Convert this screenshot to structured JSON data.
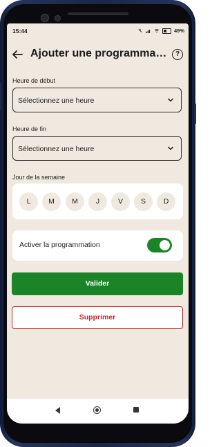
{
  "status_bar": {
    "time": "15:44",
    "battery": "49%"
  },
  "header": {
    "title": "Ajouter une programmation",
    "help_label": "?"
  },
  "form": {
    "start_time": {
      "label": "Heure de début",
      "value": "Sélectionnez une heure"
    },
    "end_time": {
      "label": "Heure de fin",
      "value": "Sélectionnez une heure"
    },
    "weekdays": {
      "label": "Jour de la semaine",
      "days": [
        "L",
        "M",
        "M",
        "J",
        "V",
        "S",
        "D"
      ]
    },
    "schedule_toggle": {
      "label": "Activer la programmation",
      "enabled": true
    }
  },
  "actions": {
    "submit_label": "Valider",
    "delete_label": "Supprimer"
  },
  "colors": {
    "background": "#efe9df",
    "primary_green": "#1b8427",
    "danger_red": "#c0252a"
  }
}
